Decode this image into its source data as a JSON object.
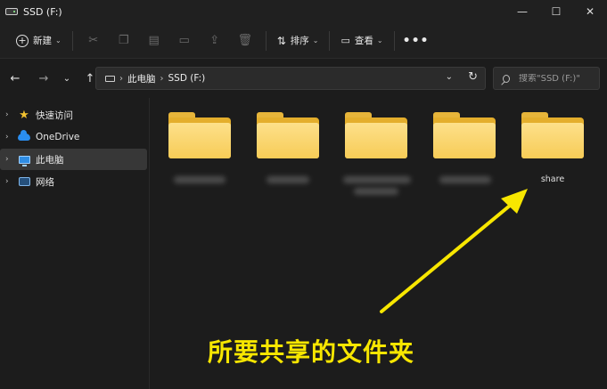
{
  "window": {
    "title": "SSD (F:)",
    "controls": [
      "—",
      "☐",
      "✕"
    ]
  },
  "toolbar": {
    "new_label": "新建",
    "sort_label": "排序",
    "view_label": "查看",
    "more": "•••"
  },
  "address": {
    "crumbs": [
      "此电脑",
      "SSD (F:)"
    ],
    "search_placeholder": "搜索\"SSD (F:)\""
  },
  "sidebar": {
    "items": [
      {
        "label": "快速访问",
        "icon": "star-icon"
      },
      {
        "label": "OneDrive",
        "icon": "cloud-icon"
      },
      {
        "label": "此电脑",
        "icon": "pc-icon",
        "selected": true
      },
      {
        "label": "网络",
        "icon": "network-icon"
      }
    ]
  },
  "content": {
    "folders": [
      {
        "label": ""
      },
      {
        "label": ""
      },
      {
        "label": ""
      },
      {
        "label": ""
      },
      {
        "label": "share"
      }
    ]
  },
  "annotation": {
    "text": "所要共享的文件夹",
    "color": "#f7e600"
  },
  "colors": {
    "background": "#1c1c1c",
    "toolbar": "#202020",
    "folder": "#f7cc57",
    "accent": "#f7e600"
  }
}
